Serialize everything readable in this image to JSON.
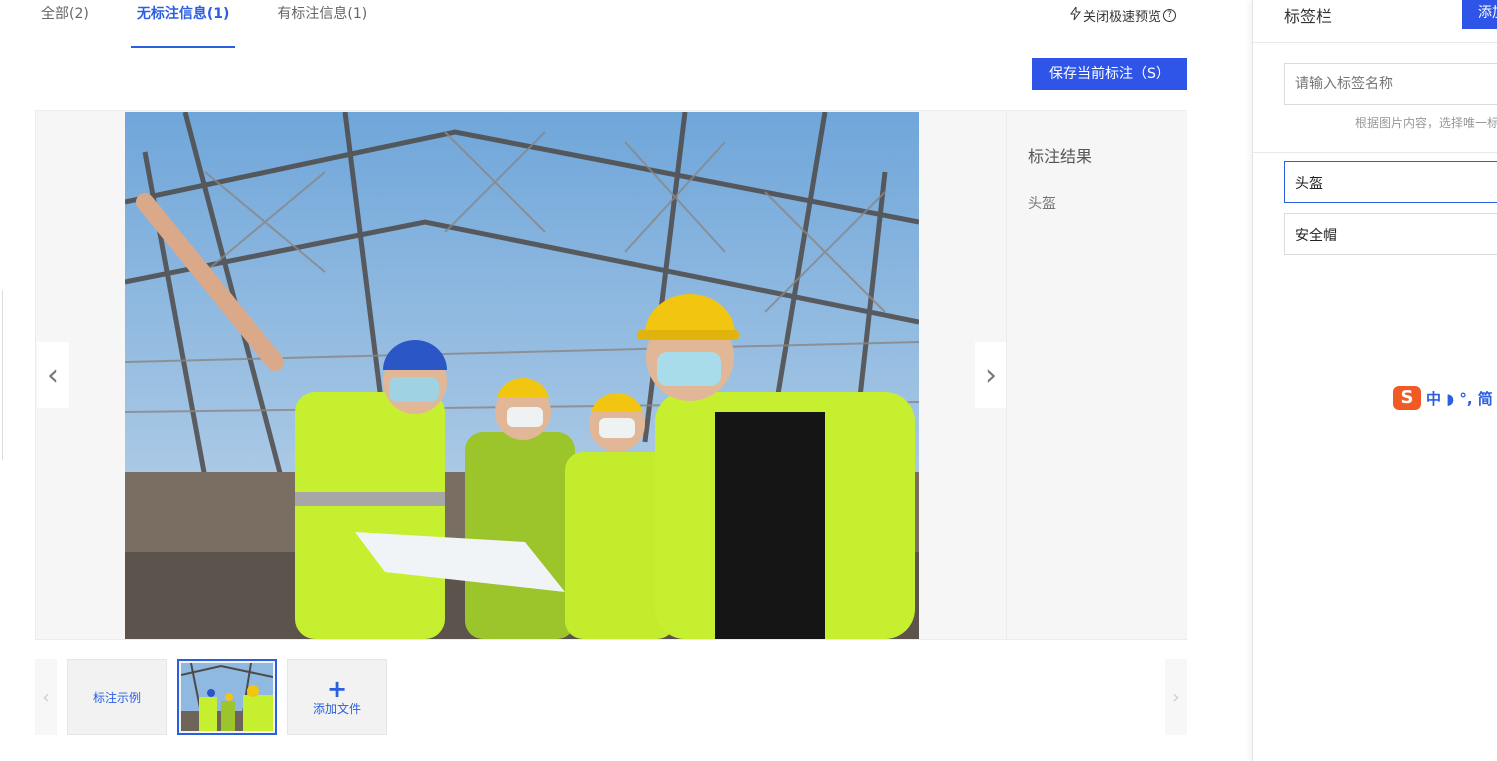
{
  "tabs": [
    {
      "label": "全部(2)"
    },
    {
      "label": "无标注信息(1)"
    },
    {
      "label": "有标注信息(1)"
    }
  ],
  "preview_toggle": {
    "label": "关闭极速预览",
    "icon": "lightning-icon"
  },
  "save_button": {
    "label": "保存当前标注（S）"
  },
  "viewer": {
    "prev_icon": "chevron-left-icon",
    "next_icon": "chevron-right-icon",
    "result_title": "标注结果",
    "result_items": [
      "头盔"
    ]
  },
  "strip": {
    "sample_label": "标注示例",
    "add_label": "添加文件",
    "add_icon": "plus-icon"
  },
  "sidebar": {
    "title": "标签栏",
    "add_button": "添加",
    "input_placeholder": "请输入标签名称",
    "hint": "根据图片内容，选择唯一标",
    "tags": [
      "头盔",
      "安全帽"
    ]
  },
  "ime": {
    "label": "中 ◗ °, 简"
  },
  "colors": {
    "accent": "#2f55e8",
    "tab_active": "#2b5fe0"
  }
}
